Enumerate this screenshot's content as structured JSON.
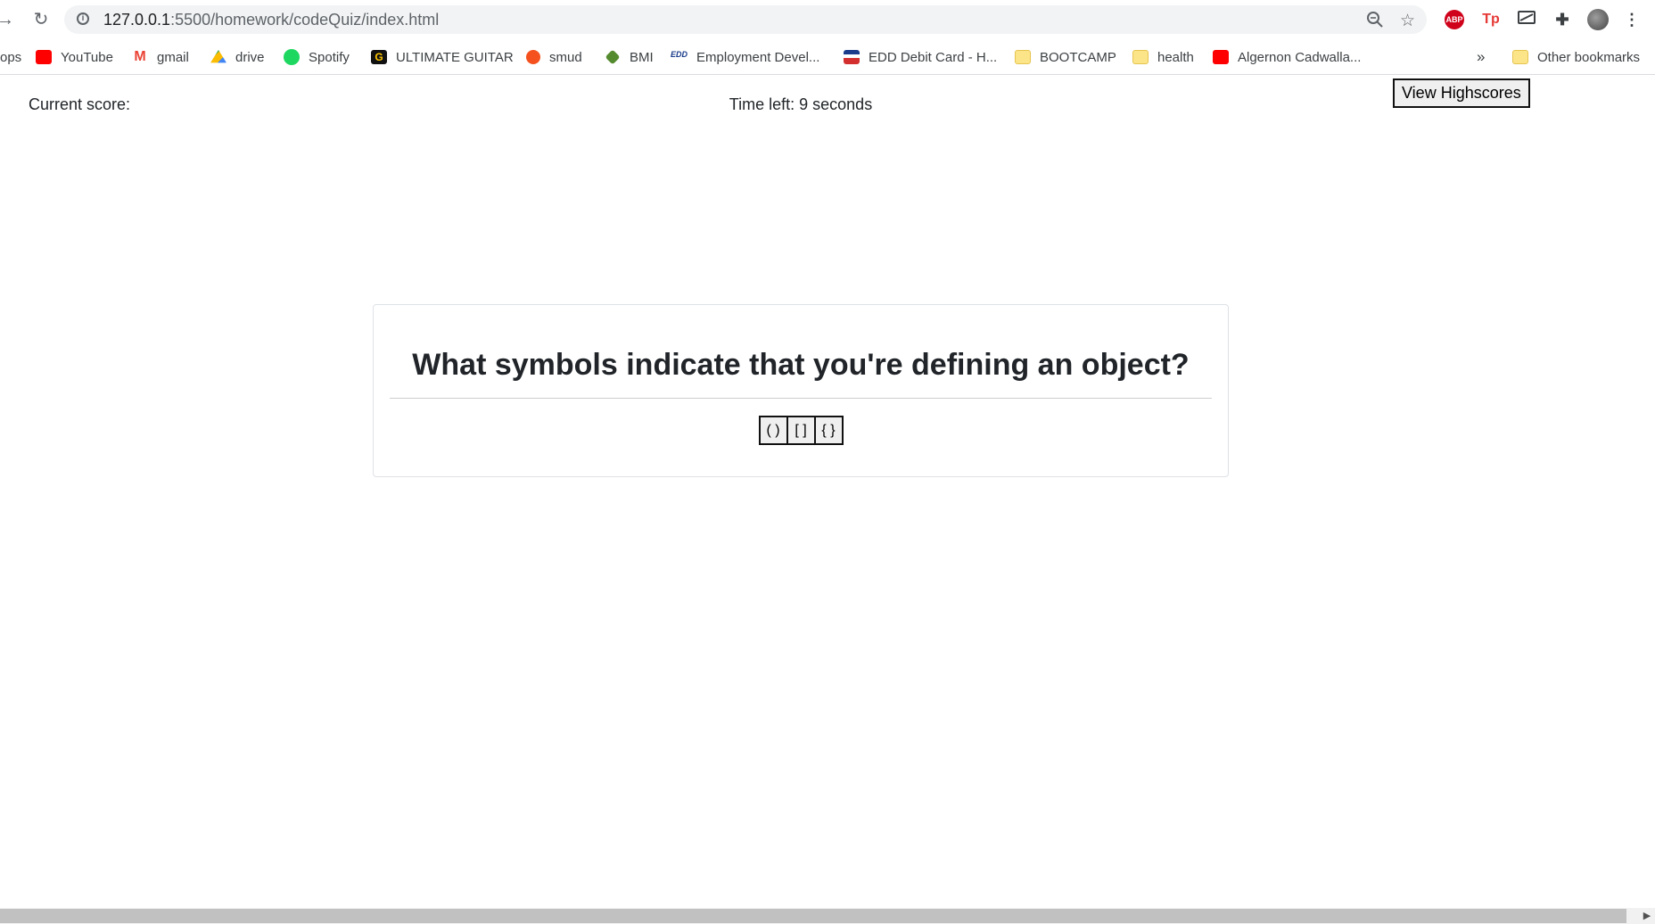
{
  "browser": {
    "url_host": "127.0.0.1",
    "url_path": ":5500/homework/codeQuiz/index.html",
    "extensions": [
      "ABP",
      "Tp"
    ],
    "bookmarks": [
      {
        "label": "ops",
        "icon": "apps-icon"
      },
      {
        "label": "YouTube",
        "icon": "youtube-icon"
      },
      {
        "label": "gmail",
        "icon": "gmail-icon"
      },
      {
        "label": "drive",
        "icon": "drive-icon"
      },
      {
        "label": "Spotify",
        "icon": "spotify-icon"
      },
      {
        "label": "ULTIMATE GUITAR",
        "icon": "ultimate-guitar-icon"
      },
      {
        "label": "smud",
        "icon": "smud-icon"
      },
      {
        "label": "BMI",
        "icon": "bmi-icon"
      },
      {
        "label": "Employment Devel...",
        "icon": "edd-icon"
      },
      {
        "label": "EDD Debit Card - H...",
        "icon": "flag-icon"
      },
      {
        "label": "BOOTCAMP",
        "icon": "folder-icon"
      },
      {
        "label": "health",
        "icon": "folder-icon"
      },
      {
        "label": "Algernon Cadwalla...",
        "icon": "youtube-icon"
      }
    ],
    "overflow": "»",
    "other_bookmarks": "Other bookmarks",
    "edd_badge": "EDD"
  },
  "page": {
    "score_label": "Current score:",
    "timer_text": "Time left: 9 seconds",
    "highscores_button": "View Highscores",
    "question": "What symbols indicate that you're defining an object?",
    "answers": [
      "( )",
      "[ ]",
      "{ }"
    ]
  },
  "colors": {
    "youtube": "#ff0000",
    "spotify": "#1ed760",
    "abp": "#d0021b",
    "folder": "#fce589"
  }
}
